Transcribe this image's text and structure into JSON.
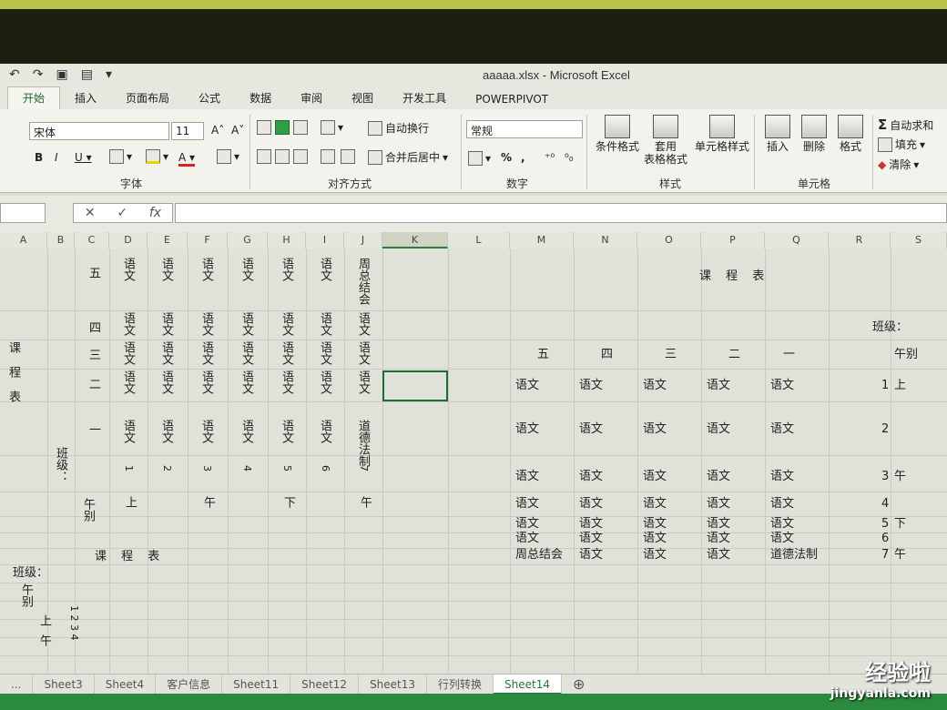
{
  "window": {
    "title": "aaaaa.xlsx - Microsoft Excel"
  },
  "tabs": [
    "开始",
    "插入",
    "页面布局",
    "公式",
    "数据",
    "审阅",
    "视图",
    "开发工具",
    "POWERPIVOT"
  ],
  "ribbon": {
    "font_name": "宋体",
    "font_size": "11",
    "wrap_text": "自动换行",
    "merge_center": "合并后居中",
    "number_format": "常规",
    "cond_format": "条件格式",
    "table_format_1": "套用",
    "table_format_2": "表格格式",
    "cell_style": "单元格样式",
    "insert": "插入",
    "delete": "删除",
    "format": "格式",
    "autosum": "自动求和",
    "fill": "填充",
    "clear": "清除",
    "group_font": "字体",
    "group_align": "对齐方式",
    "group_number": "数字",
    "group_style": "样式",
    "group_cells": "单元格"
  },
  "columns": [
    "A",
    "B",
    "C",
    "D",
    "E",
    "F",
    "G",
    "H",
    "I",
    "J",
    "K",
    "L",
    "M",
    "N",
    "O",
    "P",
    "Q",
    "R",
    "S"
  ],
  "left_table": {
    "title_vertical": "课程表",
    "class_label": "班级：",
    "row_days": [
      "五",
      "四",
      "三",
      "二",
      "一"
    ],
    "subject": "语文",
    "special_1": "周总结会",
    "special_2": "道德法制",
    "period_numbers": [
      "1",
      "2",
      "3",
      "4",
      "5",
      "6",
      "7"
    ],
    "ampm_label": "午别",
    "ampm_values": [
      "上",
      "午",
      "下",
      "午"
    ]
  },
  "right_table": {
    "title": "课 程 表",
    "class_label": "班级：",
    "ampm_header": "午别",
    "day_headers": [
      "五",
      "四",
      "三",
      "二",
      "一"
    ],
    "rows": [
      {
        "cells": [
          "语文",
          "语文",
          "语文",
          "语文",
          "语文"
        ],
        "num": "1",
        "ampm": "上"
      },
      {
        "cells": [
          "语文",
          "语文",
          "语文",
          "语文",
          "语文"
        ],
        "num": "2",
        "ampm": ""
      },
      {
        "cells": [
          "语文",
          "语文",
          "语文",
          "语文",
          "语文"
        ],
        "num": "3",
        "ampm": "午"
      },
      {
        "cells": [
          "语文",
          "语文",
          "语文",
          "语文",
          "语文"
        ],
        "num": "4",
        "ampm": ""
      },
      {
        "cells": [
          "语文",
          "语文",
          "语文",
          "语文",
          "语文"
        ],
        "num": "5",
        "ampm": "下"
      },
      {
        "cells": [
          "语文",
          "语文",
          "语文",
          "语文",
          "语文"
        ],
        "num": "6",
        "ampm": ""
      },
      {
        "cells": [
          "周总结会",
          "语文",
          "语文",
          "语文",
          "道德法制"
        ],
        "num": "7",
        "ampm": "午"
      }
    ]
  },
  "bottom_left": {
    "title": "课 程 表",
    "class_label": "班级：",
    "ampm_label": "午别",
    "up": "上",
    "noon": "午",
    "nums": "1 2 3 4"
  },
  "sheets": [
    "Sheet3",
    "Sheet4",
    "客户信息",
    "Sheet11",
    "Sheet12",
    "Sheet13",
    "行列转换",
    "Sheet14"
  ],
  "active_sheet": "Sheet14",
  "watermark": {
    "cn": "经验啦",
    "url": "jingyanla.com"
  }
}
